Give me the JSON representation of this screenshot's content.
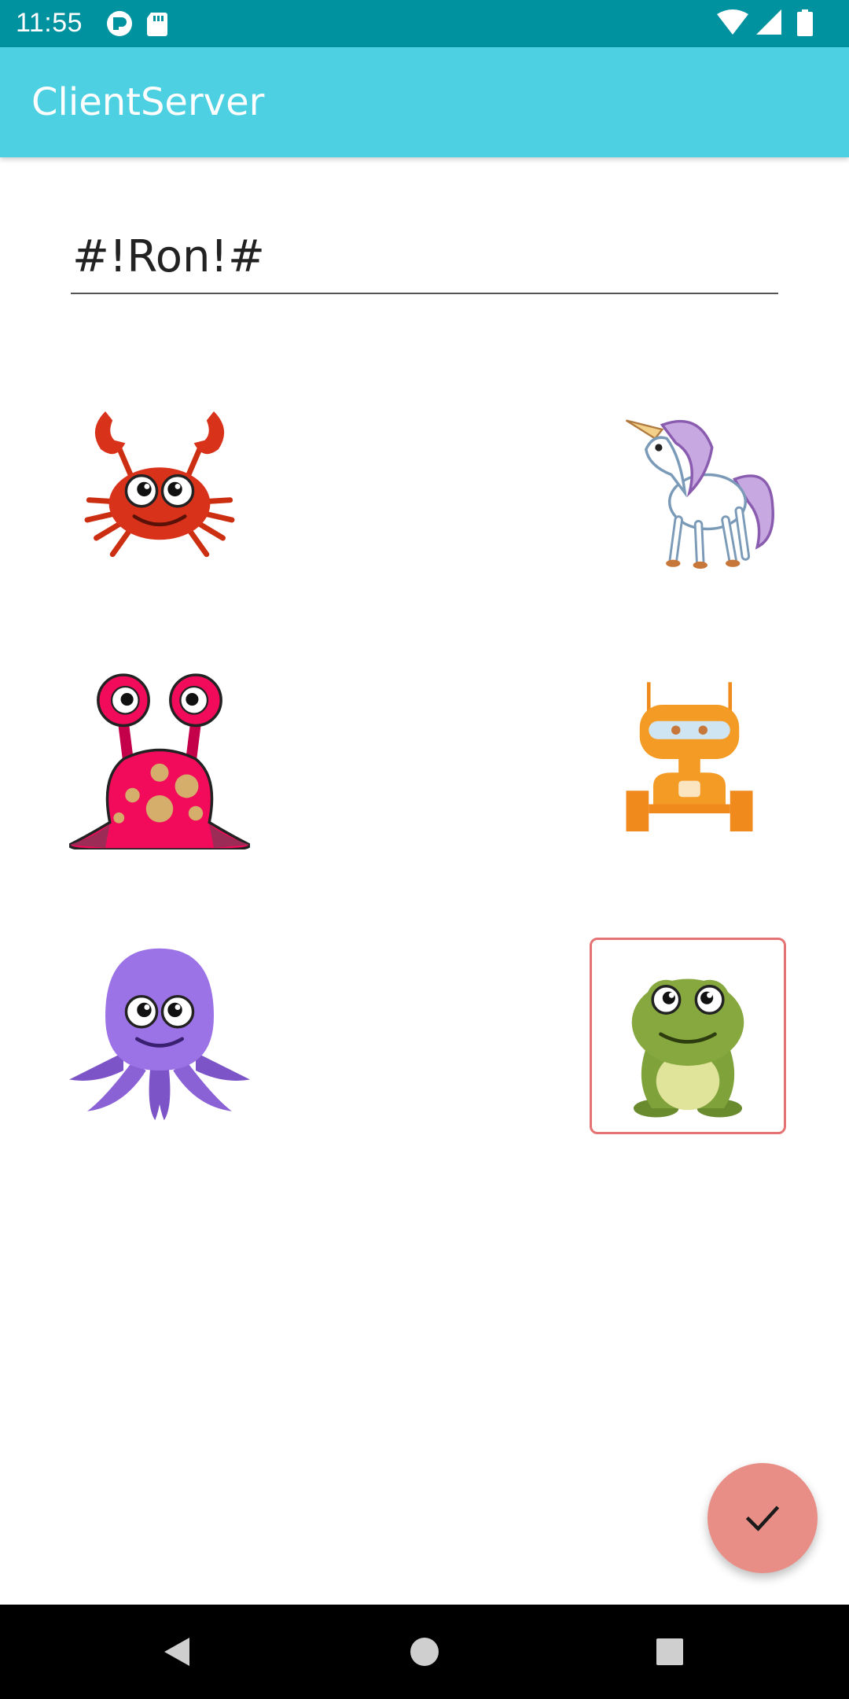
{
  "status_bar": {
    "time": "11:55",
    "left_icons": [
      "pocket-icon",
      "sd-card-icon"
    ],
    "right_icons": [
      "wifi-icon",
      "cell-signal-icon",
      "battery-icon"
    ]
  },
  "app_bar": {
    "title": "ClientServer",
    "color": "#4dd0e1"
  },
  "name_field": {
    "value": "#!Ron!#"
  },
  "avatars": [
    {
      "name": "crab",
      "icon": "crab-icon",
      "selected": false
    },
    {
      "name": "unicorn",
      "icon": "unicorn-icon",
      "selected": false
    },
    {
      "name": "pink-monster",
      "icon": "pink-monster-icon",
      "selected": false
    },
    {
      "name": "robot",
      "icon": "robot-icon",
      "selected": false
    },
    {
      "name": "octopus",
      "icon": "octopus-icon",
      "selected": false
    },
    {
      "name": "frog",
      "icon": "frog-icon",
      "selected": true
    }
  ],
  "fab": {
    "icon": "check-icon",
    "color": "#e88e86"
  },
  "nav_bar": {
    "buttons": [
      "back-icon",
      "home-icon",
      "recents-icon"
    ]
  }
}
